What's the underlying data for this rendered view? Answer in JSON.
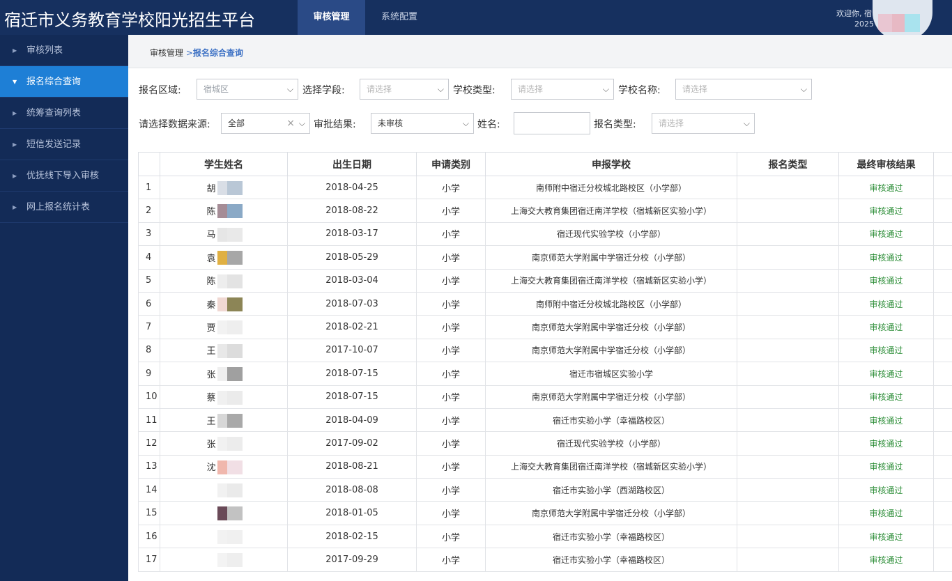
{
  "header": {
    "app_title": "宿迁市义务教育学校阳光招生平台",
    "tabs": [
      {
        "label": "审核管理",
        "active": true
      },
      {
        "label": "系统配置",
        "active": false
      }
    ],
    "welcome_line1": "欢迎你, 宿",
    "welcome_line2": "2025"
  },
  "sidebar": {
    "items": [
      {
        "label": "审核列表",
        "active": false
      },
      {
        "label": "报名综合查询",
        "active": true
      },
      {
        "label": "统筹查询列表",
        "active": false
      },
      {
        "label": "短信发送记录",
        "active": false
      },
      {
        "label": "优抚线下导入审核",
        "active": false
      },
      {
        "label": "网上报名统计表",
        "active": false
      }
    ]
  },
  "breadcrumb": {
    "root": "审核管理",
    "separator": ">",
    "current": "报名综合查询"
  },
  "filters": {
    "area_label": "报名区域:",
    "area_value": "宿城区",
    "stage_label": "选择学段:",
    "stage_placeholder": "请选择",
    "school_type_label": "学校类型:",
    "school_type_placeholder": "请选择",
    "school_name_label": "学校名称:",
    "school_name_placeholder": "请选择",
    "source_label": "请选择数据来源:",
    "source_value": "全部",
    "approval_label": "审批结果:",
    "approval_value": "未审核",
    "name_label": "姓名:",
    "name_value": "",
    "reg_type_label": "报名类型:",
    "reg_type_placeholder": "请选择"
  },
  "table": {
    "columns": [
      "",
      "学生姓名",
      "出生日期",
      "申请类别",
      "申报学校",
      "报名类型",
      "最终审核结果"
    ],
    "rows": [
      {
        "idx": "1",
        "name": "胡",
        "dob": "2018-04-25",
        "category": "小学",
        "school": "南师附中宿迁分校城北路校区（小学部）",
        "reg_type": "",
        "result": "审核通过"
      },
      {
        "idx": "2",
        "name": "陈",
        "dob": "2018-08-22",
        "category": "小学",
        "school": "上海交大教育集团宿迁南洋学校（宿城新区实验小学）",
        "reg_type": "",
        "result": "审核通过"
      },
      {
        "idx": "3",
        "name": "马",
        "dob": "2018-03-17",
        "category": "小学",
        "school": "宿迁现代实验学校（小学部）",
        "reg_type": "",
        "result": "审核通过"
      },
      {
        "idx": "4",
        "name": "袁",
        "dob": "2018-05-29",
        "category": "小学",
        "school": "南京师范大学附属中学宿迁分校（小学部）",
        "reg_type": "",
        "result": "审核通过"
      },
      {
        "idx": "5",
        "name": "陈",
        "dob": "2018-03-04",
        "category": "小学",
        "school": "上海交大教育集团宿迁南洋学校（宿城新区实验小学）",
        "reg_type": "",
        "result": "审核通过"
      },
      {
        "idx": "6",
        "name": "秦",
        "dob": "2018-07-03",
        "category": "小学",
        "school": "南师附中宿迁分校城北路校区（小学部）",
        "reg_type": "",
        "result": "审核通过"
      },
      {
        "idx": "7",
        "name": "贾",
        "dob": "2018-02-21",
        "category": "小学",
        "school": "南京师范大学附属中学宿迁分校（小学部）",
        "reg_type": "",
        "result": "审核通过"
      },
      {
        "idx": "8",
        "name": "王",
        "dob": "2017-10-07",
        "category": "小学",
        "school": "南京师范大学附属中学宿迁分校（小学部）",
        "reg_type": "",
        "result": "审核通过"
      },
      {
        "idx": "9",
        "name": "张",
        "dob": "2018-07-15",
        "category": "小学",
        "school": "宿迁市宿城区实验小学",
        "reg_type": "",
        "result": "审核通过"
      },
      {
        "idx": "10",
        "name": "蔡",
        "dob": "2018-07-15",
        "category": "小学",
        "school": "南京师范大学附属中学宿迁分校（小学部）",
        "reg_type": "",
        "result": "审核通过"
      },
      {
        "idx": "11",
        "name": "王",
        "dob": "2018-04-09",
        "category": "小学",
        "school": "宿迁市实验小学（幸福路校区）",
        "reg_type": "",
        "result": "审核通过"
      },
      {
        "idx": "12",
        "name": "张",
        "dob": "2017-09-02",
        "category": "小学",
        "school": "宿迁现代实验学校（小学部）",
        "reg_type": "",
        "result": "审核通过"
      },
      {
        "idx": "13",
        "name": "沈",
        "dob": "2018-08-21",
        "category": "小学",
        "school": "上海交大教育集团宿迁南洋学校（宿城新区实验小学）",
        "reg_type": "",
        "result": "审核通过"
      },
      {
        "idx": "14",
        "name": "",
        "dob": "2018-08-08",
        "category": "小学",
        "school": "宿迁市实验小学（西湖路校区）",
        "reg_type": "",
        "result": "审核通过"
      },
      {
        "idx": "15",
        "name": "",
        "dob": "2018-01-05",
        "category": "小学",
        "school": "南京师范大学附属中学宿迁分校（小学部）",
        "reg_type": "",
        "result": "审核通过"
      },
      {
        "idx": "16",
        "name": "",
        "dob": "2018-02-15",
        "category": "小学",
        "school": "宿迁市实验小学（幸福路校区）",
        "reg_type": "",
        "result": "审核通过"
      },
      {
        "idx": "17",
        "name": "",
        "dob": "2017-09-29",
        "category": "小学",
        "school": "宿迁市实验小学（幸福路校区）",
        "reg_type": "",
        "result": "审核通过"
      }
    ]
  },
  "icons": {
    "sidebar_arrow": "caret-right-icon",
    "sidebar_arrow_active": "caret-down-icon",
    "select_chevron": "chevron-down-icon",
    "select_clear": "close-icon"
  },
  "colors": {
    "header_bg": "#16305f",
    "sidebar_bg": "#132b57",
    "active_blue": "#1e7fd6",
    "status_green": "#2f8f3a"
  }
}
